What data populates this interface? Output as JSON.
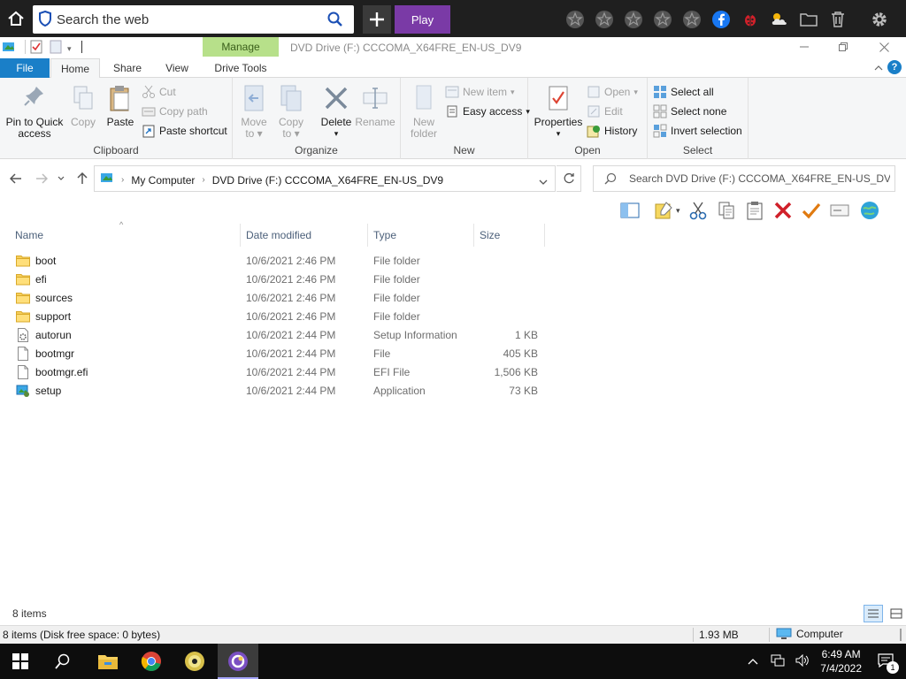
{
  "browser": {
    "search_placeholder": "Search the web",
    "play_label": "Play"
  },
  "titlebar": {
    "manage_tab": "Manage",
    "title": "DVD Drive (F:) CCCOMA_X64FRE_EN-US_DV9"
  },
  "ribbon_tabs": {
    "file": "File",
    "home": "Home",
    "share": "Share",
    "view": "View",
    "drive_tools": "Drive Tools"
  },
  "ribbon": {
    "clipboard": {
      "label": "Clipboard",
      "pin_line1": "Pin to Quick",
      "pin_line2": "access",
      "copy": "Copy",
      "paste": "Paste",
      "cut": "Cut",
      "copy_path": "Copy path",
      "paste_shortcut": "Paste shortcut"
    },
    "organize": {
      "label": "Organize",
      "move_line1": "Move",
      "move_line2": "to",
      "copy_line1": "Copy",
      "copy_line2": "to",
      "delete": "Delete",
      "rename": "Rename"
    },
    "new": {
      "label": "New",
      "folder_line1": "New",
      "folder_line2": "folder",
      "new_item": "New item",
      "easy_access": "Easy access"
    },
    "open": {
      "label": "Open",
      "properties": "Properties",
      "open": "Open",
      "edit": "Edit",
      "history": "History"
    },
    "select": {
      "label": "Select",
      "select_all": "Select all",
      "select_none": "Select none",
      "invert": "Invert selection"
    }
  },
  "address": {
    "crumb1": "My Computer",
    "crumb2": "DVD Drive (F:) CCCOMA_X64FRE_EN-US_DV9",
    "search_placeholder": "Search DVD Drive (F:) CCCOMA_X64FRE_EN-US_DV9"
  },
  "columns": {
    "name": "Name",
    "date": "Date modified",
    "type": "Type",
    "size": "Size"
  },
  "files": [
    {
      "name": "boot",
      "date": "10/6/2021 2:46 PM",
      "type": "File folder",
      "size": "",
      "icon": "folder"
    },
    {
      "name": "efi",
      "date": "10/6/2021 2:46 PM",
      "type": "File folder",
      "size": "",
      "icon": "folder"
    },
    {
      "name": "sources",
      "date": "10/6/2021 2:46 PM",
      "type": "File folder",
      "size": "",
      "icon": "folder"
    },
    {
      "name": "support",
      "date": "10/6/2021 2:46 PM",
      "type": "File folder",
      "size": "",
      "icon": "folder"
    },
    {
      "name": "autorun",
      "date": "10/6/2021 2:44 PM",
      "type": "Setup Information",
      "size": "1 KB",
      "icon": "settings-file"
    },
    {
      "name": "bootmgr",
      "date": "10/6/2021 2:44 PM",
      "type": "File",
      "size": "405 KB",
      "icon": "file"
    },
    {
      "name": "bootmgr.efi",
      "date": "10/6/2021 2:44 PM",
      "type": "EFI File",
      "size": "1,506 KB",
      "icon": "file"
    },
    {
      "name": "setup",
      "date": "10/6/2021 2:44 PM",
      "type": "Application",
      "size": "73 KB",
      "icon": "setup-app"
    }
  ],
  "footer": {
    "item_count": "8 items",
    "status_left": "8 items (Disk free space: 0 bytes)",
    "status_size": "1.93 MB",
    "status_location": "Computer"
  },
  "taskbar": {
    "time": "6:49 AM",
    "date": "7/4/2022",
    "notification_count": "1"
  },
  "colors": {
    "accent": "#1a7fc8",
    "manage": "#b7e08a",
    "play": "#7a3aa6",
    "folder": "#f6cf5b"
  }
}
